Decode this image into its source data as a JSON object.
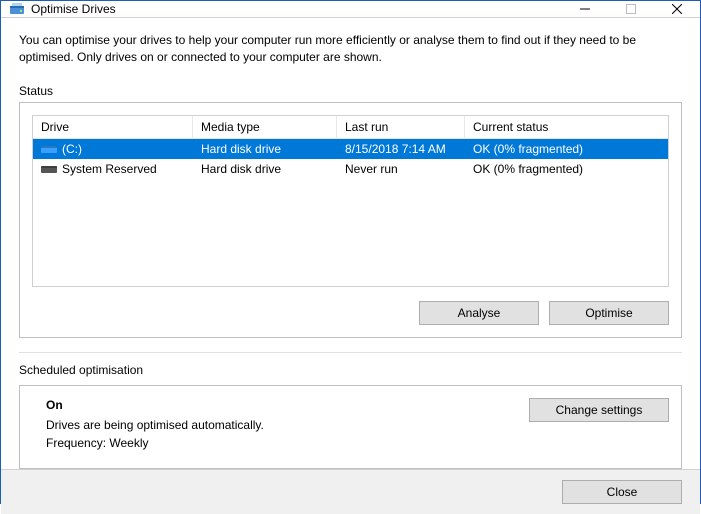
{
  "window": {
    "title": "Optimise Drives"
  },
  "description": "You can optimise your drives to help your computer run more efficiently or analyse them to find out if they need to be optimised. Only drives on or connected to your computer are shown.",
  "status": {
    "label": "Status",
    "columns": {
      "drive": "Drive",
      "media": "Media type",
      "last": "Last run",
      "status": "Current status"
    },
    "rows": [
      {
        "drive": "(C:)",
        "media": "Hard disk drive",
        "last": "8/15/2018 7:14 AM",
        "status": "OK (0% fragmented)",
        "selected": true,
        "iconColor": "#3aa0ff"
      },
      {
        "drive": "System Reserved",
        "media": "Hard disk drive",
        "last": "Never run",
        "status": "OK (0% fragmented)",
        "selected": false,
        "iconColor": "#555"
      }
    ],
    "buttons": {
      "analyse": "Analyse",
      "optimise": "Optimise"
    }
  },
  "schedule": {
    "label": "Scheduled optimisation",
    "state": "On",
    "detail": "Drives are being optimised automatically.",
    "frequency": "Frequency: Weekly",
    "change": "Change settings"
  },
  "footer": {
    "close": "Close"
  }
}
